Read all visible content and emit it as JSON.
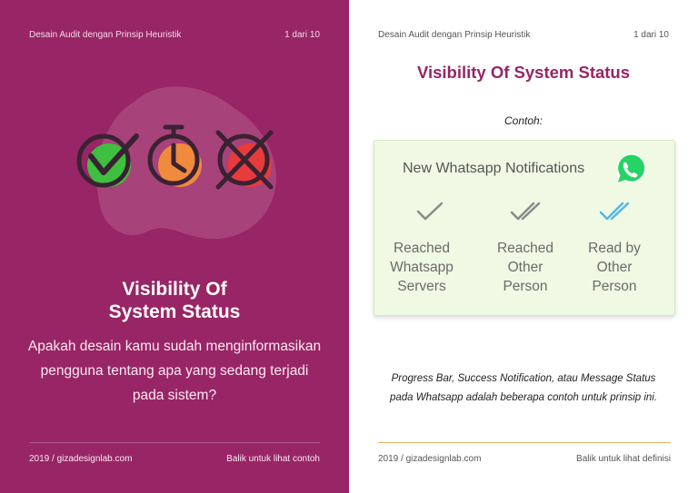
{
  "left_card": {
    "header_title": "Desain Audit dengan Prinsip Heuristik",
    "page_counter": "1 dari 10",
    "title_line1": "Visibility Of",
    "title_line2": "System Status",
    "description": "Apakah desain kamu sudah menginformasikan pengguna tentang apa yang sedang terjadi pada sistem?",
    "footer_left": "2019 / gizadesignlab.com",
    "footer_right": "Balik untuk lihat contoh",
    "icons": [
      "check-circle-icon",
      "clock-icon",
      "x-circle-icon"
    ]
  },
  "right_card": {
    "header_title": "Desain Audit dengan Prinsip Heuristik",
    "page_counter": "1 dari 10",
    "title": "Visibility Of System Status",
    "example_label": "Contoh:",
    "whatsapp": {
      "heading": "New Whatsapp Notifications",
      "logo_icon": "whatsapp-logo-icon",
      "statuses": [
        {
          "icon": "single-check-icon",
          "color": "#8a8a8a",
          "lines": [
            "Reached",
            "Whatsapp",
            "Servers"
          ]
        },
        {
          "icon": "double-check-icon",
          "color": "#8a8a8a",
          "lines": [
            "Reached",
            "Other",
            "Person"
          ]
        },
        {
          "icon": "double-check-blue-icon",
          "color": "#55b7e3",
          "lines": [
            "Read by",
            "Other",
            "Person"
          ]
        }
      ]
    },
    "description_line1": "Progress Bar, Success Notification, atau Message Status",
    "description_line2": "pada Whatsapp adalah beberapa contoh untuk prinsip ini.",
    "footer_left": "2019 / gizadesignlab.com",
    "footer_right": "Balik untuk lihat definisi"
  },
  "colors": {
    "brand_magenta": "#982566",
    "blob": "#a83f7a",
    "check_green": "#3fbf3f",
    "clock_orange": "#f08a3c",
    "x_red": "#e83b3b",
    "icon_outline": "#3b2233",
    "whatsapp_green": "#25d366",
    "read_blue": "#55b7e3",
    "divider_gold": "#e8b163"
  }
}
